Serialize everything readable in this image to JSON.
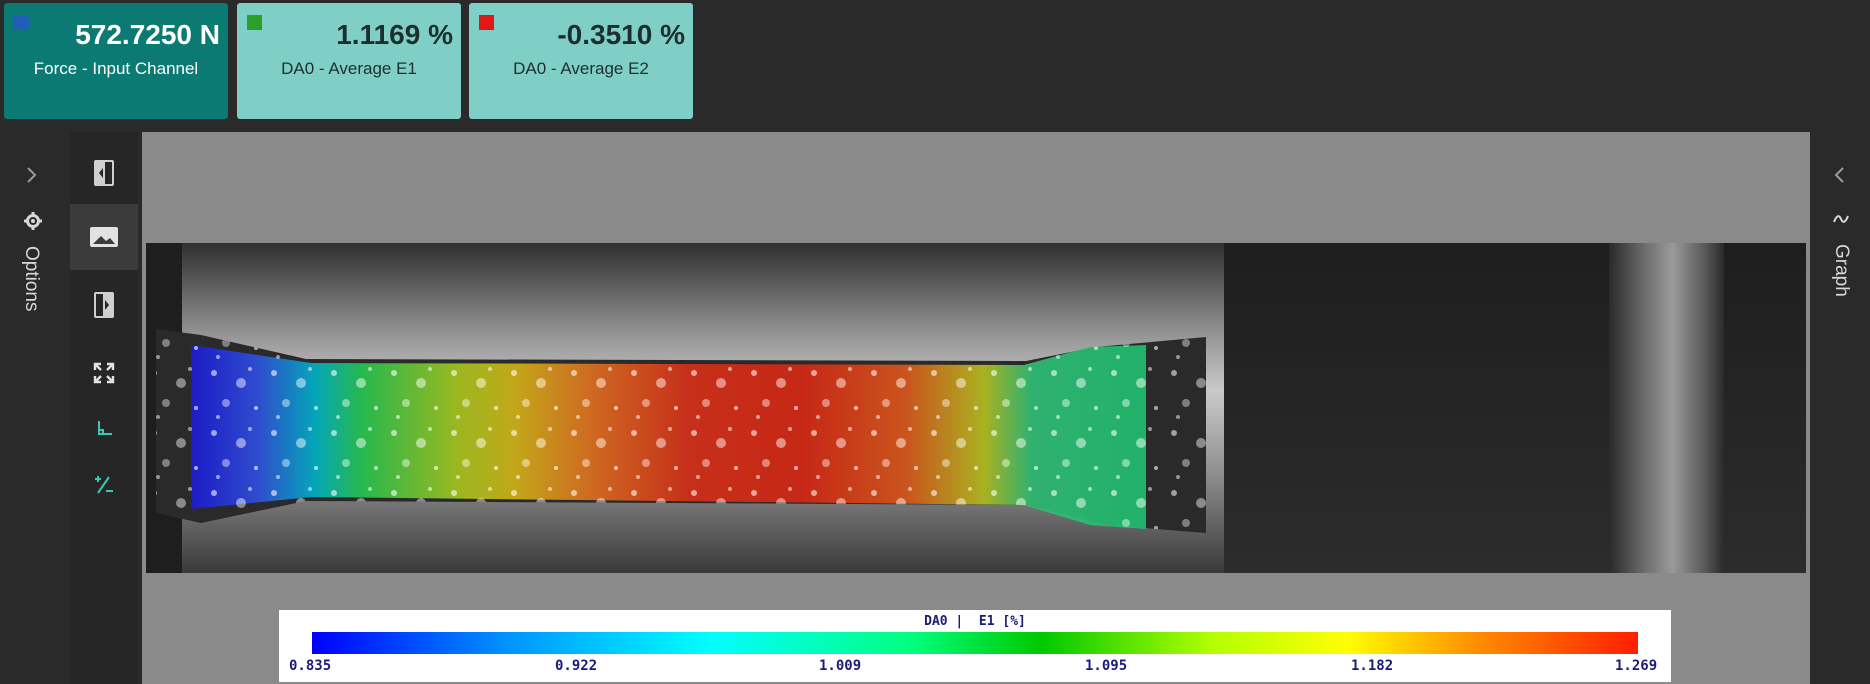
{
  "metrics": [
    {
      "value": "572.7250 N",
      "label": "Force -  Input Channel",
      "swatch": "#1f5fb8"
    },
    {
      "value": "1.1169 %",
      "label": "DA0 -  Average E1",
      "swatch": "#2aa02a"
    },
    {
      "value": "-0.3510 %",
      "label": "DA0 -  Average E2",
      "swatch": "#e01818"
    }
  ],
  "left_panel": {
    "label": "Options",
    "icon": "gear-icon",
    "toggle_icon": "chevron-right-icon"
  },
  "right_panel": {
    "label": "Graph",
    "icon": "line-chart-icon",
    "toggle_icon": "chevron-left-icon"
  },
  "toolbar": [
    {
      "icon": "collapse-left-panel-icon",
      "active": false
    },
    {
      "icon": "image-icon",
      "active": true
    },
    {
      "icon": "collapse-right-panel-icon",
      "active": false
    },
    {
      "icon": "fullscreen-icon",
      "active": false
    },
    {
      "icon": "axes-icon",
      "active": false
    },
    {
      "icon": "strain-plus-minus-icon",
      "active": false
    }
  ],
  "colorbar": {
    "title": "DA0 |  E1 [%]",
    "ticks": [
      "0.835",
      "0.922",
      "1.009",
      "1.095",
      "1.182",
      "1.269"
    ],
    "min": 0.835,
    "max": 1.269
  },
  "colors": {
    "accent": "#0b7a72",
    "tile_bg": "#7fcfc6",
    "toolbar_icon": "#3ec6b2"
  }
}
